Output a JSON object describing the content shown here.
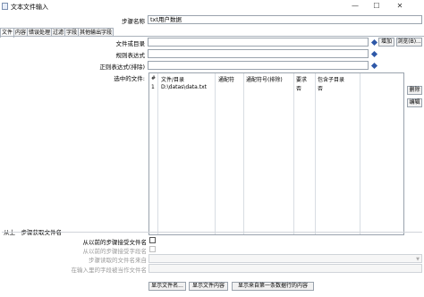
{
  "window": {
    "title": "文本文件输入",
    "minimize": "—",
    "maximize": "☐",
    "close": "✕"
  },
  "step_name": {
    "label": "步骤名称",
    "value": "txt用户数据"
  },
  "tabs": [
    "文件",
    "内容",
    "错误处理",
    "过滤",
    "字段",
    "其他输出字段"
  ],
  "fields": {
    "file_or_dir": {
      "label": "文件或目录",
      "value": ""
    },
    "regex": {
      "label": "规则表达式",
      "value": ""
    },
    "regex_exclude": {
      "label": "正则表达式(排除)",
      "value": ""
    },
    "selected_files": {
      "label": "选中的文件:"
    }
  },
  "buttons": {
    "add": "增加",
    "browse": "浏览(B)...",
    "delete": "删除",
    "edit": "编辑",
    "show_filenames": "显示文件名...",
    "show_file_content": "显示文件内容",
    "show_first_row": "显示来自第一条数据行的内容"
  },
  "grid": {
    "headers": [
      "#",
      "文件/目录",
      "通配符",
      "通配符号(排除)",
      "要求",
      "包含子目录"
    ],
    "rows": [
      {
        "num": "1",
        "path": "D:\\datas\\data.txt",
        "wildcard": "",
        "wildcard_exclude": "",
        "required": "否",
        "subdirs": "否"
      }
    ]
  },
  "prev_step": {
    "group_title": "从上一步骤获取文件名",
    "accept_label": "从以前的步骤接受文件名",
    "accept_checked": false,
    "step_label": "从以前的步骤接受字段名",
    "step_field_label": "步骤读取的文件名来自",
    "input_field_label": "在输入里的字段被当作文件名"
  }
}
